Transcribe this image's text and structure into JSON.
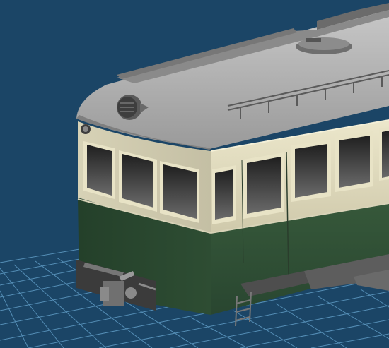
{
  "scene": {
    "subject": "tram-car-3d-model",
    "view": "perspective",
    "grid": true
  },
  "colors": {
    "background": "#1b4566",
    "grid_line": "#5f9bc4",
    "roof": "#a9a9a9",
    "upper_body_cream": "#e1dcbf",
    "lower_body_green": "#2c4a2f",
    "window_glass": "#3a3a3a",
    "undercarriage": "#5d5d5d"
  },
  "icons": [
    "headlight-icon",
    "roof-vent-icon",
    "coupler-icon",
    "step-ladder-icon"
  ]
}
